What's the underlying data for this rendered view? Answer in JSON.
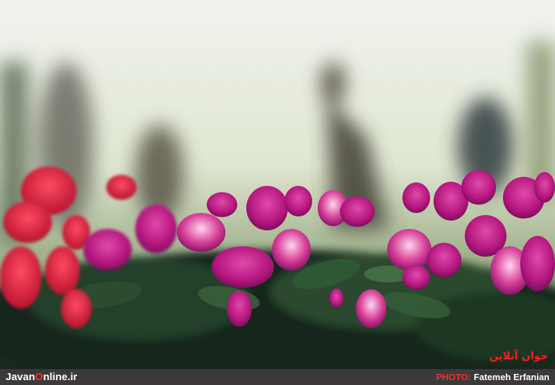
{
  "photo": {
    "subject": "cyclamen-flowers",
    "colors": {
      "magenta": "#c21a8e",
      "pink": "#e0408f",
      "red": "#e8233f",
      "leaf": "#1f3a1e",
      "background": "#e6ecd8"
    }
  },
  "watermark": {
    "logo_text": "جوان آنلاین"
  },
  "footer": {
    "site_prefix": "Javan",
    "site_accent": "O",
    "site_suffix": "nline.ir",
    "photo_label": "PHOTO:",
    "photographer": "Fatemeh Erfanian"
  }
}
